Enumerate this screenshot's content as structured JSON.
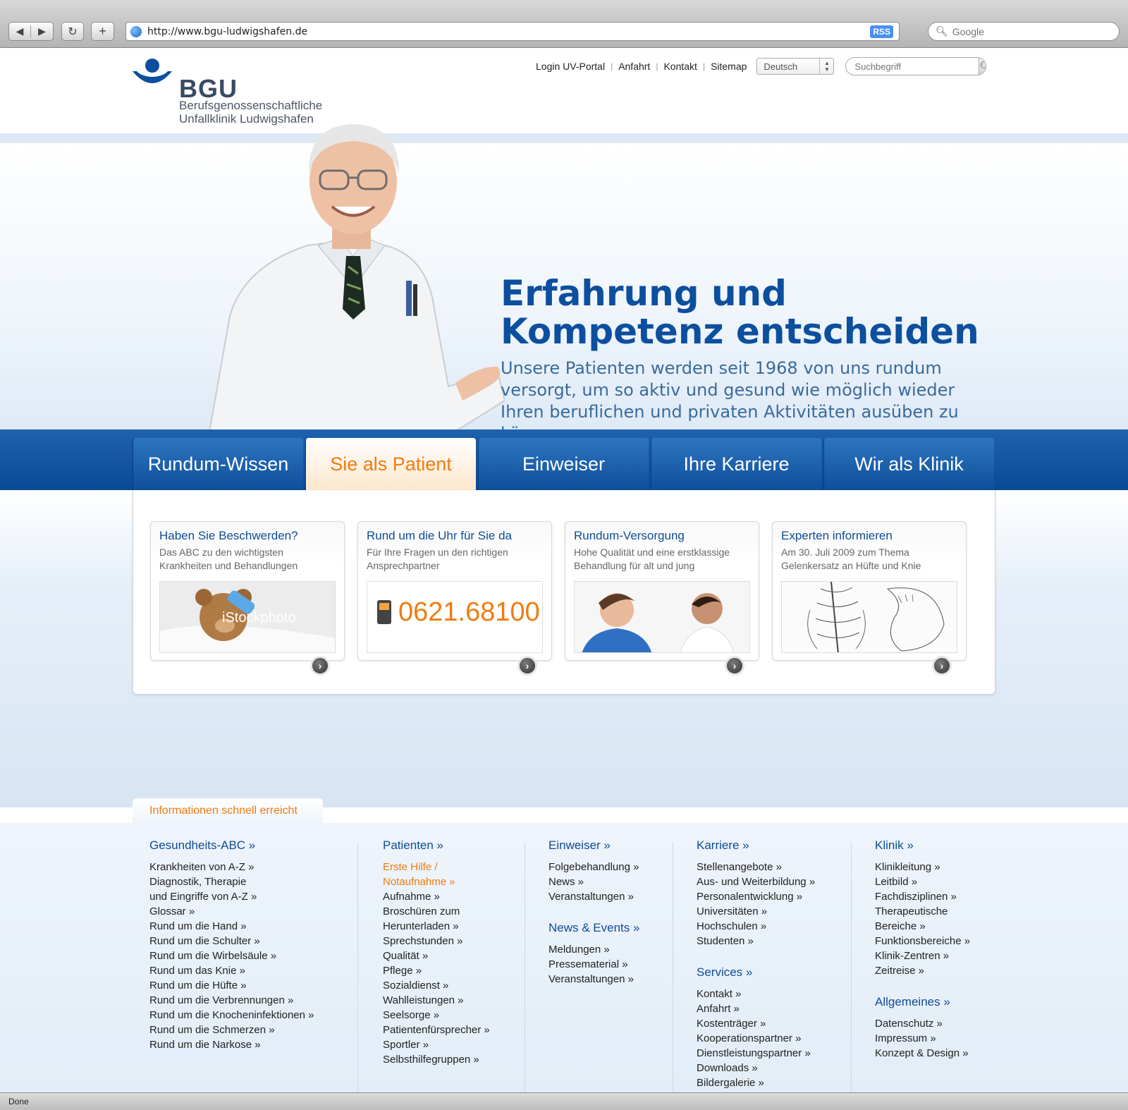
{
  "browser": {
    "url": "http://www.bgu-ludwigshafen.de",
    "rss_label": "RSS",
    "search_placeholder": "Google",
    "status": "Done"
  },
  "logo": {
    "short": "BGU",
    "line1": "Berufsgenossenschaftliche",
    "line2": "Unfallklinik Ludwigshafen"
  },
  "topnav": {
    "items": [
      "Login UV-Portal",
      "Anfahrt",
      "Kontakt",
      "Sitemap"
    ],
    "language": "Deutsch",
    "search_placeholder": "Suchbegriff"
  },
  "hero": {
    "title_line1": "Erfahrung und",
    "title_line2": "Kompetenz entscheiden",
    "text": "Unsere Patienten werden seit 1968 von uns rundum versorgt, um so aktiv und gesund wie möglich wieder Ihren beruflichen und privaten Aktivitäten ausüben zu können."
  },
  "tabs": [
    {
      "label": "Rundum-Wissen"
    },
    {
      "label": "Sie als Patient"
    },
    {
      "label": "Einweiser"
    },
    {
      "label": "Ihre Karriere"
    },
    {
      "label": "Wir als Klinik"
    }
  ],
  "cards": [
    {
      "title": "Haben Sie Beschwerden?",
      "text": "Das ABC zu den wichtigsten Krankheiten und Behandlungen",
      "image": "teddy-bear-bandage",
      "image_caption": "iStockphoto"
    },
    {
      "title": "Rund um die Uhr für Sie da",
      "text": "Für Ihre Fragen un den richtigen Ansprechpartner",
      "phone": "0621.68100"
    },
    {
      "title": "Rundum-Versorgung",
      "text": "Hohe Qualität und eine erstklassige Behandlung für alt und jung",
      "image": "nurse-and-child"
    },
    {
      "title": "Experten informieren",
      "text": "Am 30. Juli 2009 zum Thema Gelenkersatz an Hüfte und Knie",
      "image": "spine-hip-drawing"
    }
  ],
  "footer": {
    "tab_label": "Informationen schnell erreicht",
    "col1": {
      "heading": "Gesundheits-ABC »",
      "items": [
        "Krankheiten von A-Z »",
        "Diagnostik, Therapie",
        "und Eingriffe von A-Z »",
        "Glossar »",
        "Rund um die Hand »",
        "Rund um die Schulter »",
        "Rund um die Wirbelsäule »",
        "Rund um das Knie »",
        "Rund um die Hüfte »",
        "Rund um die Verbrennungen »",
        "Rund um die Knocheninfektionen »",
        "Rund um die Schmerzen »",
        "Rund um die Narkose »"
      ]
    },
    "col2": {
      "heading": "Patienten »",
      "items_orange": [
        "Erste Hilfe /",
        "Notaufnahme »"
      ],
      "items": [
        "Aufnahme »",
        "Broschüren zum",
        "Herunterladen »",
        "Sprechstunden »",
        "Qualität »",
        "Pflege »",
        "Sozialdienst »",
        "Wahlleistungen »",
        "Seelsorge »",
        "Patientenfürsprecher »",
        "Sportler »",
        "Selbsthilfegruppen »"
      ]
    },
    "col3": {
      "heading": "Einweiser »",
      "items": [
        "Folgebehandlung »",
        "News »",
        "Veranstaltungen »"
      ],
      "heading2": "News & Events »",
      "items2": [
        "Meldungen »",
        "Pressematerial »",
        "Veranstaltungen »"
      ]
    },
    "col4": {
      "heading": "Karriere »",
      "items": [
        "Stellenangebote »",
        "Aus- und Weiterbildung »",
        "Personalentwicklung »",
        "Universitäten »",
        "Hochschulen »",
        "Studenten »"
      ],
      "heading2": "Services »",
      "items2": [
        "Kontakt »",
        "Anfahrt »",
        "Kostenträger »",
        "Kooperationspartner »",
        "Dienstleistungspartner »",
        "Downloads »",
        "Bildergalerie »"
      ]
    },
    "col5": {
      "heading": "Klinik »",
      "items": [
        "Klinikleitung »",
        "Leitbild »",
        "Fachdisziplinen »",
        "Therapeutische",
        "Bereiche »",
        "Funktionsbereiche »",
        "Klinik-Zentren »",
        "Zeitreise »"
      ],
      "heading2": "Allgemeines »",
      "items2": [
        "Datenschutz »",
        "Impressum »",
        "Konzept & Design »"
      ]
    }
  },
  "colors": {
    "brand_blue": "#0c4f9e",
    "accent_orange": "#f07b10"
  }
}
